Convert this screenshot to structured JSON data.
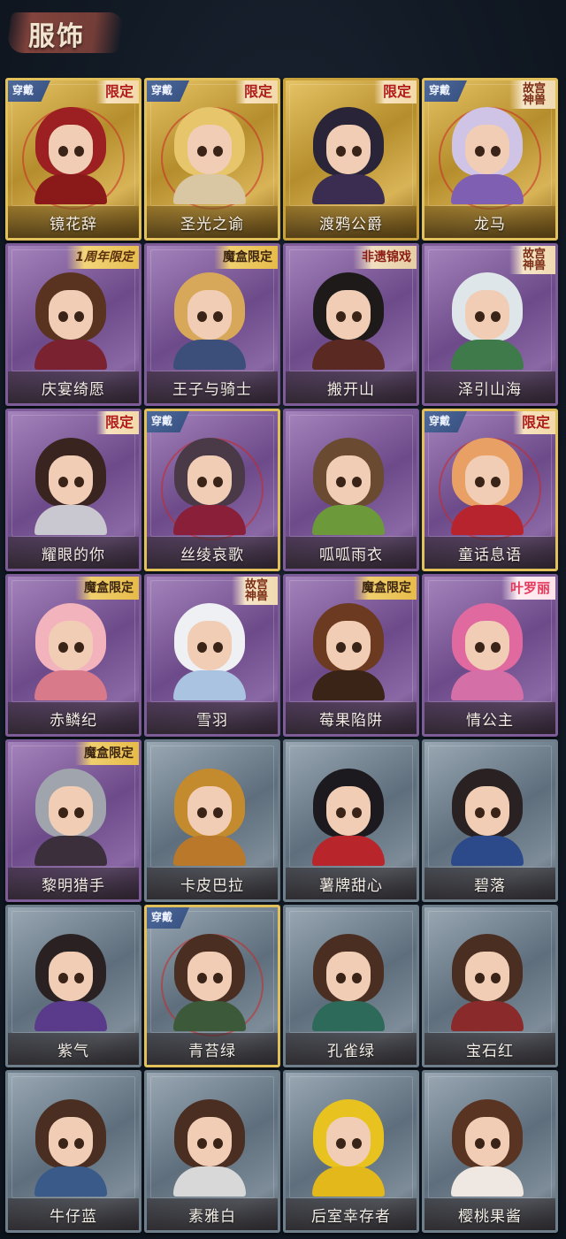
{
  "header": {
    "title": "服饰"
  },
  "labels": {
    "equipped": "穿戴"
  },
  "colors": {
    "gold_card": "#c9a13a",
    "purple_card": "#7d5c98",
    "gray_card": "#6f7e8b",
    "tag_red": "#b01c1c",
    "equipped_badge": "#4f6a9c"
  },
  "costumes": [
    {
      "name": "镜花辞",
      "frame": "gold",
      "equipped": true,
      "tag": "限定",
      "tag_style": "xianding",
      "hair": "#9c1f22",
      "outfit": "#8a1a1a"
    },
    {
      "name": "圣光之谕",
      "frame": "gold",
      "equipped": true,
      "tag": "限定",
      "tag_style": "xianding",
      "hair": "#e6c56b",
      "outfit": "#d9c7a4"
    },
    {
      "name": "渡鸦公爵",
      "frame": "gold",
      "equipped": false,
      "tag": "限定",
      "tag_style": "xianding",
      "hair": "#2a2438",
      "outfit": "#3b2d52"
    },
    {
      "name": "龙马",
      "frame": "gold",
      "equipped": true,
      "tag": "故宫神兽",
      "tag_style": "gugong",
      "hair": "#cfc3e6",
      "outfit": "#7f5fb1"
    },
    {
      "name": "庆宴绮愿",
      "frame": "purple",
      "equipped": false,
      "tag": "1周年限定",
      "tag_style": "zhounian",
      "hair": "#5a3220",
      "outfit": "#7a2230"
    },
    {
      "name": "王子与骑士",
      "frame": "purple",
      "equipped": false,
      "tag": "魔盒限定",
      "tag_style": "mohe",
      "hair": "#d8a85a",
      "outfit": "#3c4f7a"
    },
    {
      "name": "搬开山",
      "frame": "purple",
      "equipped": false,
      "tag": "非遗锦戏",
      "tag_style": "feiyi",
      "hair": "#1e1a1a",
      "outfit": "#5a2a22"
    },
    {
      "name": "泽引山海",
      "frame": "purple",
      "equipped": false,
      "tag": "故宫神兽",
      "tag_style": "gugong",
      "hair": "#dfe6ea",
      "outfit": "#3f7a4a"
    },
    {
      "name": "耀眼的你",
      "frame": "purple",
      "equipped": false,
      "tag": "限定",
      "tag_style": "xianding",
      "hair": "#3a2420",
      "outfit": "#c9c7cf"
    },
    {
      "name": "丝绫哀歌",
      "frame": "purple",
      "equipped": true,
      "tag": "",
      "tag_style": "",
      "hair": "#4a3a48",
      "outfit": "#8a1f3a"
    },
    {
      "name": "呱呱雨衣",
      "frame": "purple",
      "equipped": false,
      "tag": "",
      "tag_style": "",
      "hair": "#6a4a30",
      "outfit": "#6c9a3a"
    },
    {
      "name": "童话息语",
      "frame": "purple",
      "equipped": true,
      "tag": "限定",
      "tag_style": "xianding",
      "hair": "#e8a064",
      "outfit": "#b8242e"
    },
    {
      "name": "赤鳞纪",
      "frame": "purple",
      "equipped": false,
      "tag": "魔盒限定",
      "tag_style": "mohe",
      "hair": "#f2b3bd",
      "outfit": "#d97a8a"
    },
    {
      "name": "雪羽",
      "frame": "purple",
      "equipped": false,
      "tag": "故宫神兽",
      "tag_style": "gugong",
      "hair": "#eef0f4",
      "outfit": "#a9c3e0"
    },
    {
      "name": "莓果陷阱",
      "frame": "purple",
      "equipped": false,
      "tag": "魔盒限定",
      "tag_style": "mohe",
      "hair": "#6b3a20",
      "outfit": "#3a2418"
    },
    {
      "name": "情公主",
      "frame": "purple",
      "equipped": false,
      "tag": "叶罗丽",
      "tag_style": "luoli",
      "hair": "#e06aa0",
      "outfit": "#d56fa8"
    },
    {
      "name": "黎明猎手",
      "frame": "purple",
      "equipped": false,
      "tag": "魔盒限定",
      "tag_style": "mohe",
      "hair": "#a0a4ac",
      "outfit": "#3a2f3a"
    },
    {
      "name": "卡皮巴拉",
      "frame": "gray",
      "equipped": false,
      "tag": "",
      "tag_style": "",
      "hair": "#c48a2e",
      "outfit": "#b9782a"
    },
    {
      "name": "薯牌甜心",
      "frame": "gray",
      "equipped": false,
      "tag": "",
      "tag_style": "",
      "hair": "#1c1a1e",
      "outfit": "#b8262c"
    },
    {
      "name": "碧落",
      "frame": "gray",
      "equipped": false,
      "tag": "",
      "tag_style": "",
      "hair": "#2a2222",
      "outfit": "#2c4a8a"
    },
    {
      "name": "紫气",
      "frame": "gray",
      "equipped": false,
      "tag": "",
      "tag_style": "",
      "hair": "#2a2222",
      "outfit": "#5a3a8a"
    },
    {
      "name": "青苔绿",
      "frame": "gray",
      "equipped": true,
      "tag": "",
      "tag_style": "",
      "hair": "#4a2e22",
      "outfit": "#3c5a3a"
    },
    {
      "name": "孔雀绿",
      "frame": "gray",
      "equipped": false,
      "tag": "",
      "tag_style": "",
      "hair": "#4a2e22",
      "outfit": "#2e6a5a"
    },
    {
      "name": "宝石红",
      "frame": "gray",
      "equipped": false,
      "tag": "",
      "tag_style": "",
      "hair": "#4a2e22",
      "outfit": "#8a2a2a"
    },
    {
      "name": "牛仔蓝",
      "frame": "gray",
      "equipped": false,
      "tag": "",
      "tag_style": "",
      "hair": "#4a2e22",
      "outfit": "#3a5a8a"
    },
    {
      "name": "素雅白",
      "frame": "gray",
      "equipped": false,
      "tag": "",
      "tag_style": "",
      "hair": "#4a2e22",
      "outfit": "#d8d8d8"
    },
    {
      "name": "后室幸存者",
      "frame": "gray",
      "equipped": false,
      "tag": "",
      "tag_style": "",
      "hair": "#e8c21e",
      "outfit": "#e2b81a"
    },
    {
      "name": "樱桃果酱",
      "frame": "gray",
      "equipped": false,
      "tag": "",
      "tag_style": "",
      "hair": "#5a3422",
      "outfit": "#efe8e2"
    }
  ]
}
